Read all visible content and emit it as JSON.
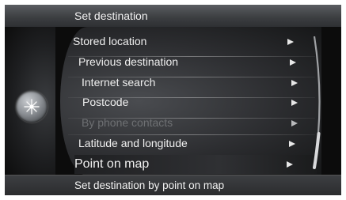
{
  "header": {
    "title": "Set destination"
  },
  "menu": {
    "items": [
      {
        "label": "Stored location",
        "enabled": true
      },
      {
        "label": "Previous destination",
        "enabled": true
      },
      {
        "label": "Internet search",
        "enabled": true
      },
      {
        "label": "Postcode",
        "enabled": true
      },
      {
        "label": "By phone contacts",
        "enabled": false
      },
      {
        "label": "Latitude and longitude",
        "enabled": true
      },
      {
        "label": "Point on map",
        "enabled": true,
        "selected": true
      }
    ]
  },
  "status": {
    "text": "Set destination by point on map"
  },
  "icons": {
    "knob": "navigation-knob-icon",
    "arrow": "arrow-right-icon"
  },
  "colors": {
    "background": "#0c0c0c",
    "text": "#f0f0f0",
    "disabled_text": "#6e7073"
  }
}
